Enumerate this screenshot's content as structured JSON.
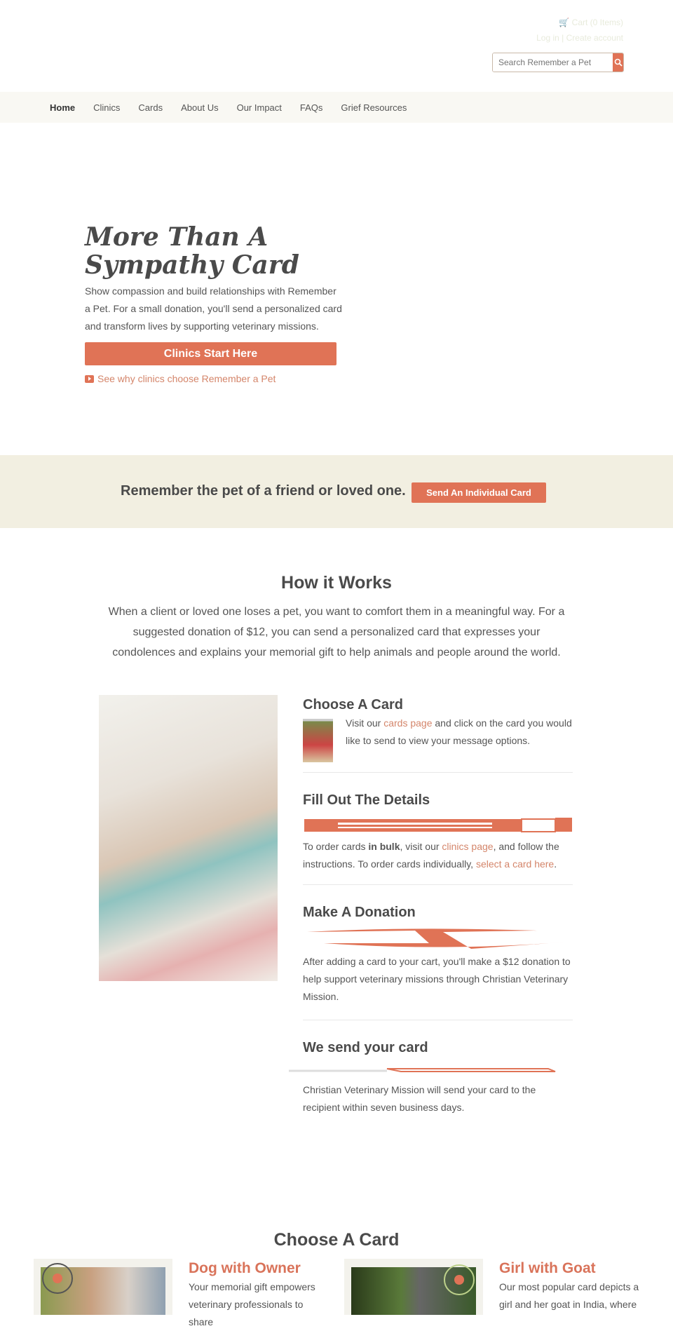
{
  "header": {
    "cart": "Cart (0 Items)",
    "login": "Log in",
    "separator": "|",
    "create_account": "Create account",
    "search_placeholder": "Search Remember a Pet"
  },
  "nav": {
    "items": [
      "Home",
      "Clinics",
      "Cards",
      "About Us",
      "Our Impact",
      "FAQs",
      "Grief Resources"
    ],
    "active": "Home"
  },
  "hero": {
    "title_line1": "More Than A",
    "title_line2": "Sympathy Card",
    "text": "Show compassion and build relationships with Remember a Pet. For a small donation, you'll send a personalized card and transform lives by supporting veterinary missions.",
    "button": "Clinics Start Here",
    "video_link": "See why clinics choose Remember a Pet"
  },
  "band": {
    "text": "Remember the pet of a friend or loved one.",
    "button": "Send An Individual Card"
  },
  "how": {
    "title": "How it Works",
    "text": "When a client or loved one loses a pet, you want to comfort them in a meaningful way. For a suggested donation of $12, you can send a personalized card that expresses your condolences and explains your memorial gift to help animals and people around the world."
  },
  "steps": [
    {
      "title": "Choose A Card",
      "pre": "Visit our ",
      "link": "cards page",
      "post": " and click on the card you would like to send to view your message options."
    },
    {
      "title": "Fill Out The Details",
      "p1": "To order cards ",
      "bold": "in bulk",
      "p2": ", visit our ",
      "link1": "clinics page",
      "p3": ", and follow the instructions. To order cards individually, ",
      "link2": "select a card here",
      "p4": "."
    },
    {
      "title": "Make A Donation",
      "text": "After adding a card to your cart, you'll make a $12 donation to help support veterinary missions through Christian Veterinary Mission."
    },
    {
      "title": "We send your card",
      "text": "Christian Veterinary Mission will send your card to the recipient within seven business days."
    }
  ],
  "cards_section": {
    "title": "Choose A Card",
    "cards": [
      {
        "title": "Dog with Owner",
        "text": "Your memorial gift empowers veterinary professionals to share"
      },
      {
        "title": "Girl with Goat",
        "text": "Our most popular card depicts a girl and her goat in India, where"
      }
    ],
    "stamp": "REMEMBER A PET"
  },
  "colors": {
    "accent": "#e07356",
    "band": "#f2efe1",
    "nav_bg": "#f9f8f3"
  }
}
